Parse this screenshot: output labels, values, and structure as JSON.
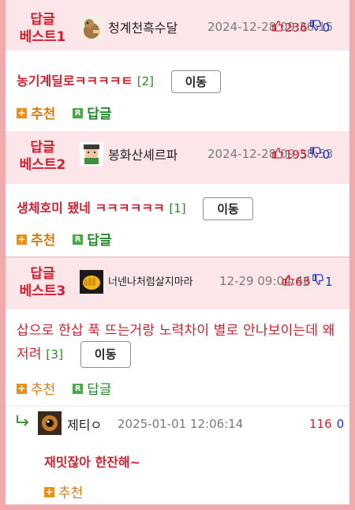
{
  "posts": [
    {
      "best_line1": "답글",
      "best_line2": "베스트1",
      "nickname": "청계천흑수달",
      "date": "2024-12-28 09:36:15",
      "up": "236",
      "down": "0",
      "title": "농기계딜로ㅋㅋㅋㅋㅌ",
      "reply_count": "[2]",
      "move_label": "이동",
      "recommend_label": "추천",
      "reply_label": "답글"
    },
    {
      "best_line1": "답글",
      "best_line2": "베스트2",
      "nickname": "봉화산셰르파",
      "date": "2024-12-28 09:38:53",
      "up": "195",
      "down": "0",
      "title": "생체호미 됐네 ㅋㅋㅋㅋㅋㅋ",
      "reply_count": "[1]",
      "move_label": "이동",
      "recommend_label": "추천",
      "reply_label": "답글"
    },
    {
      "best_line1": "답글",
      "best_line2": "베스트3",
      "nickname": "너넨나처럼살지마라",
      "date": "12-29 09:04:46",
      "up": "63",
      "down": "1",
      "title": "삽으로 한삽 푹 뜨는거랑 노력차이 별로 안나보이는데 왜저려",
      "reply_count": "[3]",
      "move_label": "이동",
      "recommend_label": "추천",
      "reply_label": "답글"
    }
  ],
  "reply": {
    "nickname": "제티ㅇ",
    "date": "2025-01-01 12:06:14",
    "up": "116",
    "down": "0",
    "text": "재밋잖아 한잔해~",
    "recommend_label": "추천"
  },
  "colors": {
    "accent_red": "#d01f2e",
    "best_bg": "#fde6ea",
    "frame_pink": "#f2a9ad",
    "count_green": "#2b8a1e",
    "down_blue": "#1f2fbf",
    "recommend_orange": "#d87a12"
  }
}
